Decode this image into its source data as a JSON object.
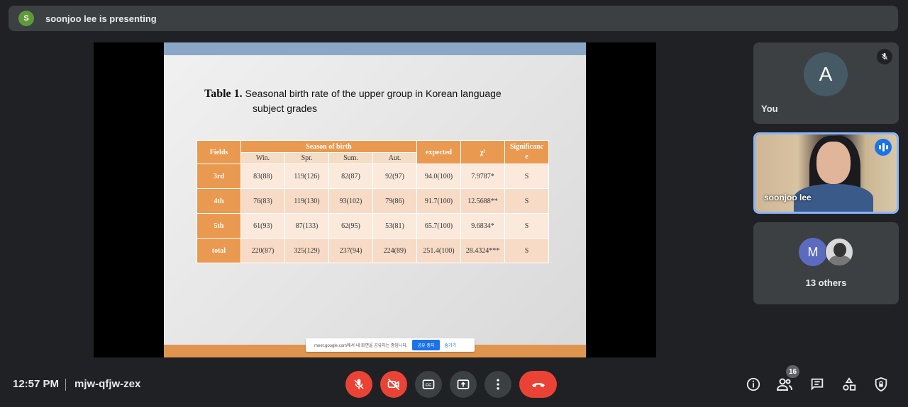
{
  "banner": {
    "avatar_letter": "S",
    "text": "soonjoo lee is presenting"
  },
  "slide": {
    "title_label": "Table 1.",
    "title_line1": "Seasonal birth rate of the upper group in Korean language",
    "title_line2": "subject grades",
    "table": {
      "col_fields": "Fields",
      "col_season": "Season of birth",
      "col_expected": "expected",
      "col_chi": "χ²",
      "col_significance": "Significanc\ne",
      "season_subheads": [
        "Win.",
        "Spr.",
        "Sum.",
        "Aut."
      ],
      "rows": [
        {
          "label": "3rd",
          "cells": [
            "83(88)",
            "119(126)",
            "82(87)",
            "92(97)",
            "94.0(100)",
            "7.9787*",
            "S"
          ]
        },
        {
          "label": "4th",
          "cells": [
            "76(83)",
            "119(130)",
            "93(102)",
            "79(86)",
            "91.7(100)",
            "12.5688**",
            "S"
          ]
        },
        {
          "label": "5th",
          "cells": [
            "61(93)",
            "87(133)",
            "62(95)",
            "53(81)",
            "65.7(100)",
            "9.6834*",
            "S"
          ]
        },
        {
          "label": "total",
          "cells": [
            "220(87)",
            "325(129)",
            "237(94)",
            "224(89)",
            "251.4(100)",
            "28.4324***",
            "S"
          ]
        }
      ]
    },
    "share_notice": {
      "text": "meet.google.com에서 내 화면을 공유하는 중입니다.",
      "stop_label": "공유 중지",
      "hide_label": "숨기기"
    }
  },
  "tiles": {
    "you": {
      "avatar_letter": "A",
      "name": "You"
    },
    "speaker": {
      "name": "soonjoo lee"
    },
    "others": {
      "avatar_letter": "M",
      "count_label": "13 others"
    }
  },
  "bottom": {
    "time": "12:57 PM",
    "meeting_code": "mjw-qfjw-zex",
    "participant_count": "16"
  },
  "colors": {
    "end_call": "#ea4335",
    "accent": "#8ab4f8",
    "table_header": "#ea9950"
  }
}
